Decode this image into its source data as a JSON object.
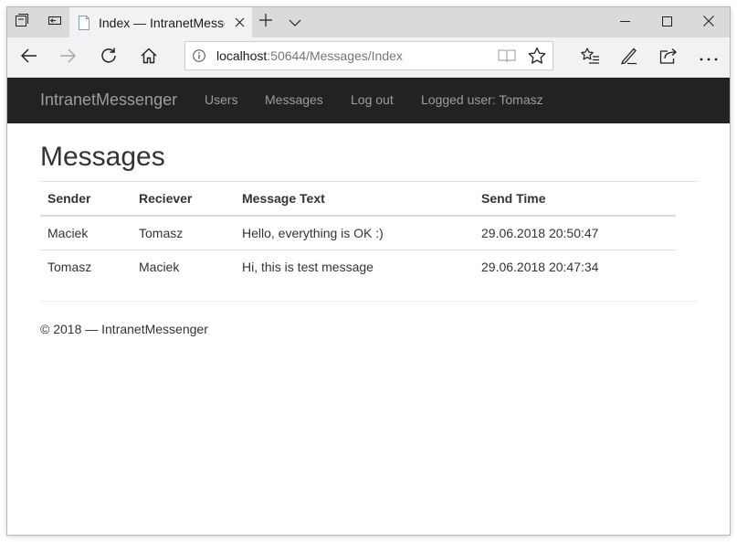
{
  "browser": {
    "tab_title": "Index — IntranetMessenger",
    "address": {
      "host": "localhost",
      "rest": ":50644/Messages/Index"
    },
    "icons": {
      "tab_actions": "tabs-aside-icon",
      "tab_preview": "tab-preview-icon",
      "new_tab": "plus-icon",
      "tab_list": "chevron-down-icon",
      "back": "back-arrow-icon",
      "forward": "forward-arrow-icon",
      "refresh": "refresh-icon",
      "home": "home-icon",
      "info": "info-icon",
      "reading_view": "book-icon",
      "favorite": "star-icon",
      "favorites_hub": "favorites-list-icon",
      "notes": "pen-icon",
      "share": "share-icon",
      "more": "ellipsis-icon"
    }
  },
  "site": {
    "brand": "IntranetMessenger",
    "nav": {
      "users": "Users",
      "messages": "Messages",
      "logout": "Log out",
      "logged_user": "Logged user: Tomasz"
    },
    "page_title": "Messages",
    "table": {
      "headers": [
        "Sender",
        "Reciever",
        "Message Text",
        "Send Time"
      ],
      "rows": [
        [
          "Maciek",
          "Tomasz",
          "Hello, everything is OK :)",
          "29.06.2018 20:50:47"
        ],
        [
          "Tomasz",
          "Maciek",
          "Hi, this is test message",
          "29.06.2018 20:47:34"
        ]
      ]
    },
    "footer": "© 2018 — IntranetMessenger"
  }
}
